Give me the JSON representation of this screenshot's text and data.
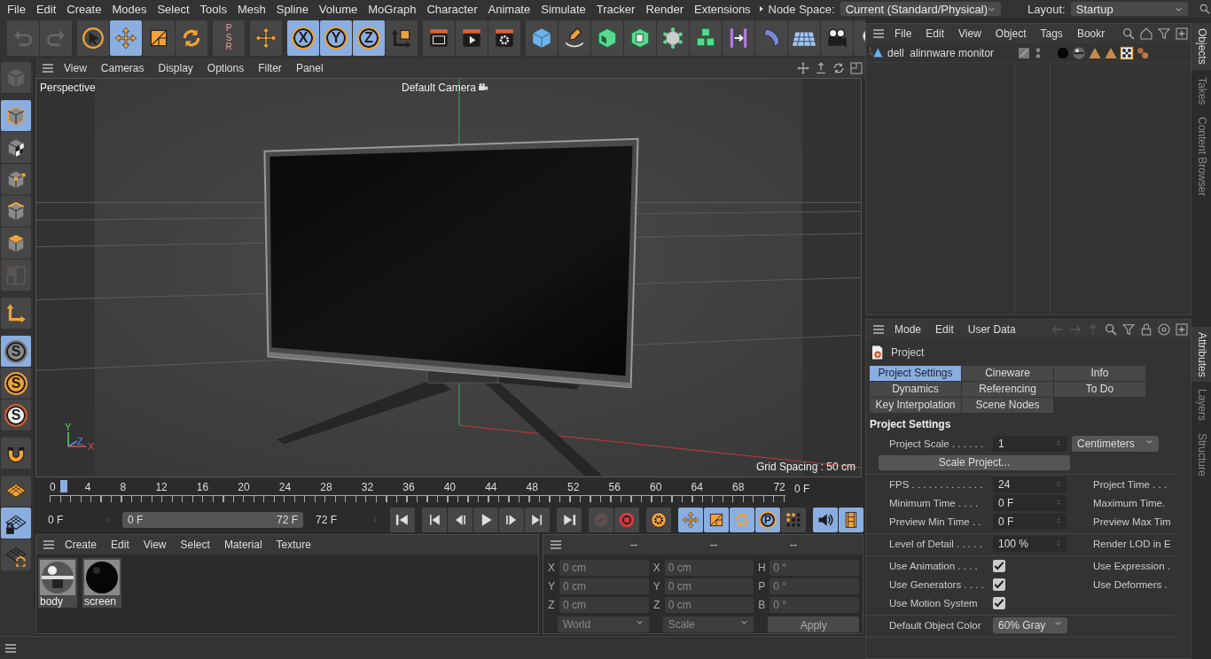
{
  "menu_bar": {
    "items": [
      "File",
      "Edit",
      "Create",
      "Modes",
      "Select",
      "Tools",
      "Mesh",
      "Spline",
      "Volume",
      "MoGraph",
      "Character",
      "Animate",
      "Simulate",
      "Tracker",
      "Render",
      "Extensions"
    ],
    "node_space": {
      "label": "Node Space:",
      "value": "Current (Standard/Physical)"
    },
    "layout": {
      "label": "Layout:",
      "value": "Startup"
    }
  },
  "toolbar": [
    {
      "items": [
        {
          "kind": "undo",
          "selected": false,
          "disabled": true
        },
        {
          "kind": "redo",
          "selected": false,
          "disabled": true
        }
      ]
    },
    {
      "items": [
        {
          "kind": "cursor",
          "selected": false,
          "disabled": false
        },
        {
          "kind": "move",
          "selected": true,
          "disabled": false
        },
        {
          "kind": "scale",
          "selected": false,
          "disabled": false
        },
        {
          "kind": "rotate",
          "selected": false,
          "disabled": false
        }
      ]
    },
    {
      "items": [
        {
          "kind": "psr",
          "label": "PSR",
          "selected": false,
          "disabled": true
        }
      ]
    },
    {
      "items": [
        {
          "kind": "move",
          "selected": false,
          "disabled": false
        }
      ]
    },
    {
      "items": [
        {
          "kind": "letter",
          "label": "X",
          "selected": true,
          "disabled": false
        },
        {
          "kind": "letter",
          "label": "Y",
          "selected": true,
          "disabled": false
        },
        {
          "kind": "letter",
          "label": "Z",
          "selected": true,
          "disabled": false
        },
        {
          "kind": "axes",
          "selected": false,
          "disabled": false
        }
      ]
    },
    {
      "items": [
        {
          "kind": "clapper",
          "selected": false,
          "disabled": false
        },
        {
          "kind": "clapper_play",
          "selected": false,
          "disabled": false
        },
        {
          "kind": "clapper_gear",
          "selected": false,
          "disabled": false
        }
      ]
    },
    {
      "items": [
        {
          "kind": "cube",
          "selected": false,
          "disabled": false
        },
        {
          "kind": "pen",
          "selected": false,
          "disabled": false
        },
        {
          "kind": "cube_frame",
          "selected": false,
          "disabled": false
        },
        {
          "kind": "cube_extrude",
          "selected": false,
          "disabled": false
        },
        {
          "kind": "cube_nodes",
          "selected": false,
          "disabled": false
        },
        {
          "kind": "cube_stack",
          "selected": false,
          "disabled": false
        },
        {
          "kind": "bracket",
          "selected": false,
          "disabled": false
        },
        {
          "kind": "bent",
          "selected": false,
          "disabled": false
        },
        {
          "kind": "plane_grid",
          "selected": false,
          "disabled": false
        },
        {
          "kind": "camera",
          "selected": false,
          "disabled": false
        },
        {
          "kind": "bulb",
          "selected": false,
          "disabled": false
        }
      ]
    }
  ],
  "left_toolbar": [
    {
      "items": [
        {
          "kind": "mode_cube",
          "selected": false,
          "disabled": true
        }
      ]
    },
    {
      "items": [
        {
          "kind": "model_cube",
          "selected": true,
          "disabled": false
        },
        {
          "kind": "texture_cube",
          "selected": false,
          "disabled": false
        },
        {
          "kind": "points_cube",
          "selected": false,
          "disabled": false
        },
        {
          "kind": "edges_cube",
          "selected": false,
          "disabled": false
        },
        {
          "kind": "polys_cube",
          "selected": false,
          "disabled": false
        },
        {
          "kind": "uv",
          "selected": false,
          "disabled": true
        }
      ]
    },
    {
      "items": [
        {
          "kind": "axis_l",
          "selected": false,
          "disabled": false
        }
      ]
    },
    {
      "items": [
        {
          "kind": "snap",
          "label": "S",
          "selected": true,
          "disabled": false
        },
        {
          "kind": "snap_orange",
          "label": "S",
          "selected": false,
          "disabled": false
        },
        {
          "kind": "snap_ring",
          "label": "S",
          "selected": false,
          "disabled": false
        }
      ]
    },
    {
      "items": [
        {
          "kind": "magnet",
          "selected": false,
          "disabled": false
        }
      ]
    },
    {
      "items": [
        {
          "kind": "grid_plane",
          "selected": false,
          "disabled": false
        },
        {
          "kind": "grid_lock",
          "selected": true,
          "disabled": false
        },
        {
          "kind": "grid_rotate",
          "selected": false,
          "disabled": false
        }
      ]
    }
  ],
  "viewport": {
    "menu": [
      "View",
      "Cameras",
      "Display",
      "Options",
      "Filter",
      "Panel"
    ],
    "camera_label": "Perspective",
    "camera_name": "Default Camera",
    "grid_spacing": "Grid Spacing : 50 cm",
    "axis_labels": [
      "Y",
      "Z",
      "X"
    ]
  },
  "timeline": {
    "ruler": [
      "0",
      "4",
      "8",
      "12",
      "16",
      "20",
      "24",
      "28",
      "32",
      "36",
      "40",
      "44",
      "48",
      "52",
      "56",
      "60",
      "64",
      "68",
      "72"
    ],
    "playhead": {
      "level": 0
    },
    "current_frame": "0 F",
    "start": "0 F",
    "range": {
      "start": "0 F",
      "end": "72 F",
      "level": 1
    },
    "end": "72 F",
    "controls": [
      {
        "items": [
          {
            "kind": "first",
            "selected": false,
            "disabled": false
          }
        ]
      },
      {
        "items": [
          {
            "kind": "prev_key",
            "selected": false,
            "disabled": false
          },
          {
            "kind": "prev_frame",
            "selected": false,
            "disabled": false
          },
          {
            "kind": "play",
            "selected": false,
            "disabled": false
          },
          {
            "kind": "next_frame",
            "selected": false,
            "disabled": false
          },
          {
            "kind": "next_key",
            "selected": false,
            "disabled": false
          }
        ]
      },
      {
        "items": [
          {
            "kind": "last",
            "selected": false,
            "disabled": false
          }
        ]
      },
      {
        "items": [
          {
            "kind": "record",
            "selected": false,
            "disabled": true
          },
          {
            "kind": "autokey",
            "selected": false,
            "disabled": false
          }
        ]
      },
      {
        "items": [
          {
            "kind": "key_gear",
            "selected": false,
            "disabled": false
          }
        ]
      },
      {
        "items": [
          {
            "kind": "move",
            "selected": true,
            "disabled": false
          },
          {
            "kind": "scale",
            "selected": true,
            "disabled": false
          },
          {
            "kind": "rotate",
            "selected": true,
            "disabled": false
          },
          {
            "kind": "letter",
            "label": "P",
            "selected": true,
            "disabled": false
          },
          {
            "kind": "dots",
            "selected": false,
            "disabled": false
          }
        ]
      },
      {
        "items": [
          {
            "kind": "sound",
            "selected": true,
            "disabled": false
          },
          {
            "kind": "film",
            "selected": true,
            "disabled": false
          }
        ]
      }
    ]
  },
  "material_manager": {
    "menu": [
      "Create",
      "Edit",
      "View",
      "Select",
      "Material",
      "Texture"
    ],
    "materials": [
      {
        "name": "body",
        "kind": "chrome"
      },
      {
        "name": "screen",
        "kind": "black"
      }
    ]
  },
  "coordinates": {
    "headers": [
      "--",
      "--",
      "--"
    ],
    "disabled": true,
    "columns": [
      [
        {
          "axis": "X",
          "value": "0 cm"
        },
        {
          "axis": "Y",
          "value": "0 cm"
        },
        {
          "axis": "Z",
          "value": "0 cm"
        }
      ],
      [
        {
          "axis": "X",
          "value": "0 cm"
        },
        {
          "axis": "Y",
          "value": "0 cm"
        },
        {
          "axis": "Z",
          "value": "0 cm"
        }
      ],
      [
        {
          "axis": "H",
          "value": "0 °"
        },
        {
          "axis": "P",
          "value": "0 °"
        },
        {
          "axis": "B",
          "value": "0 °"
        }
      ]
    ],
    "dropdowns": [
      "World",
      "Scale"
    ],
    "apply": "Apply"
  },
  "object_manager": {
    "menu": [
      "File",
      "Edit",
      "View",
      "Object",
      "Tags",
      "Bookr"
    ],
    "objects": [
      {
        "name": "dell  alinnware monitor",
        "tags": [
          {
            "kind": "sphere_black"
          },
          {
            "kind": "sphere_material"
          },
          {
            "kind": "triangle"
          },
          {
            "kind": "triangle"
          },
          {
            "kind": "checker"
          },
          {
            "kind": "dots_pair"
          }
        ]
      }
    ]
  },
  "attributes": {
    "menu": [
      "Mode",
      "Edit",
      "User Data"
    ],
    "object": "Project",
    "tabs": [
      {
        "label": "Project Settings",
        "selected": true
      },
      {
        "label": "Cineware",
        "selected": false
      },
      {
        "label": "Info",
        "selected": false
      },
      {
        "label": "Dynamics",
        "selected": false
      },
      {
        "label": "Referencing",
        "selected": false
      },
      {
        "label": "To Do",
        "selected": false
      },
      {
        "label": "Key Interpolation",
        "selected": false
      },
      {
        "label": "Scene Nodes",
        "selected": false
      }
    ],
    "section": "Project Settings",
    "groups": [
      [
        {
          "kind": "field",
          "label": "Project Scale . . . . . .",
          "value": "1",
          "unit": "Centimeters"
        },
        {
          "kind": "button",
          "label": "Scale Project..."
        }
      ],
      [
        {
          "kind": "field",
          "label": "FPS . . . . . . . . . . . . .",
          "value": "24",
          "right_label": "Project Time . . ."
        },
        {
          "kind": "field",
          "label": "Minimum Time . . . .",
          "value": "0 F",
          "right_label": "Maximum Time."
        },
        {
          "kind": "field",
          "label": "Preview Min Time . .",
          "value": "0 F",
          "right_label": "Preview Max Tim"
        }
      ],
      [
        {
          "kind": "field",
          "label": "Level of Detail . . . . .",
          "value": "100 %",
          "right_label": "Render LOD in E"
        }
      ],
      [
        {
          "kind": "checkbox",
          "label": "Use Animation . . . .",
          "checked": true,
          "right_label": "Use Expression ."
        },
        {
          "kind": "checkbox",
          "label": "Use Generators . . . .",
          "checked": true,
          "right_label": "Use Deformers ."
        },
        {
          "kind": "checkbox",
          "label": "Use Motion System",
          "checked": true
        }
      ],
      [
        {
          "kind": "dropdown",
          "label": "Default Object Color",
          "value": "60% Gray"
        }
      ]
    ]
  },
  "side_tabs": {
    "top": [
      {
        "label": "Objects",
        "selected": true
      },
      {
        "label": "Takes",
        "selected": false
      },
      {
        "label": "Content Browser",
        "selected": false
      }
    ],
    "bottom": [
      {
        "label": "Attributes",
        "selected": true
      },
      {
        "label": "Layers",
        "selected": false
      },
      {
        "label": "Structure",
        "selected": false
      }
    ]
  }
}
